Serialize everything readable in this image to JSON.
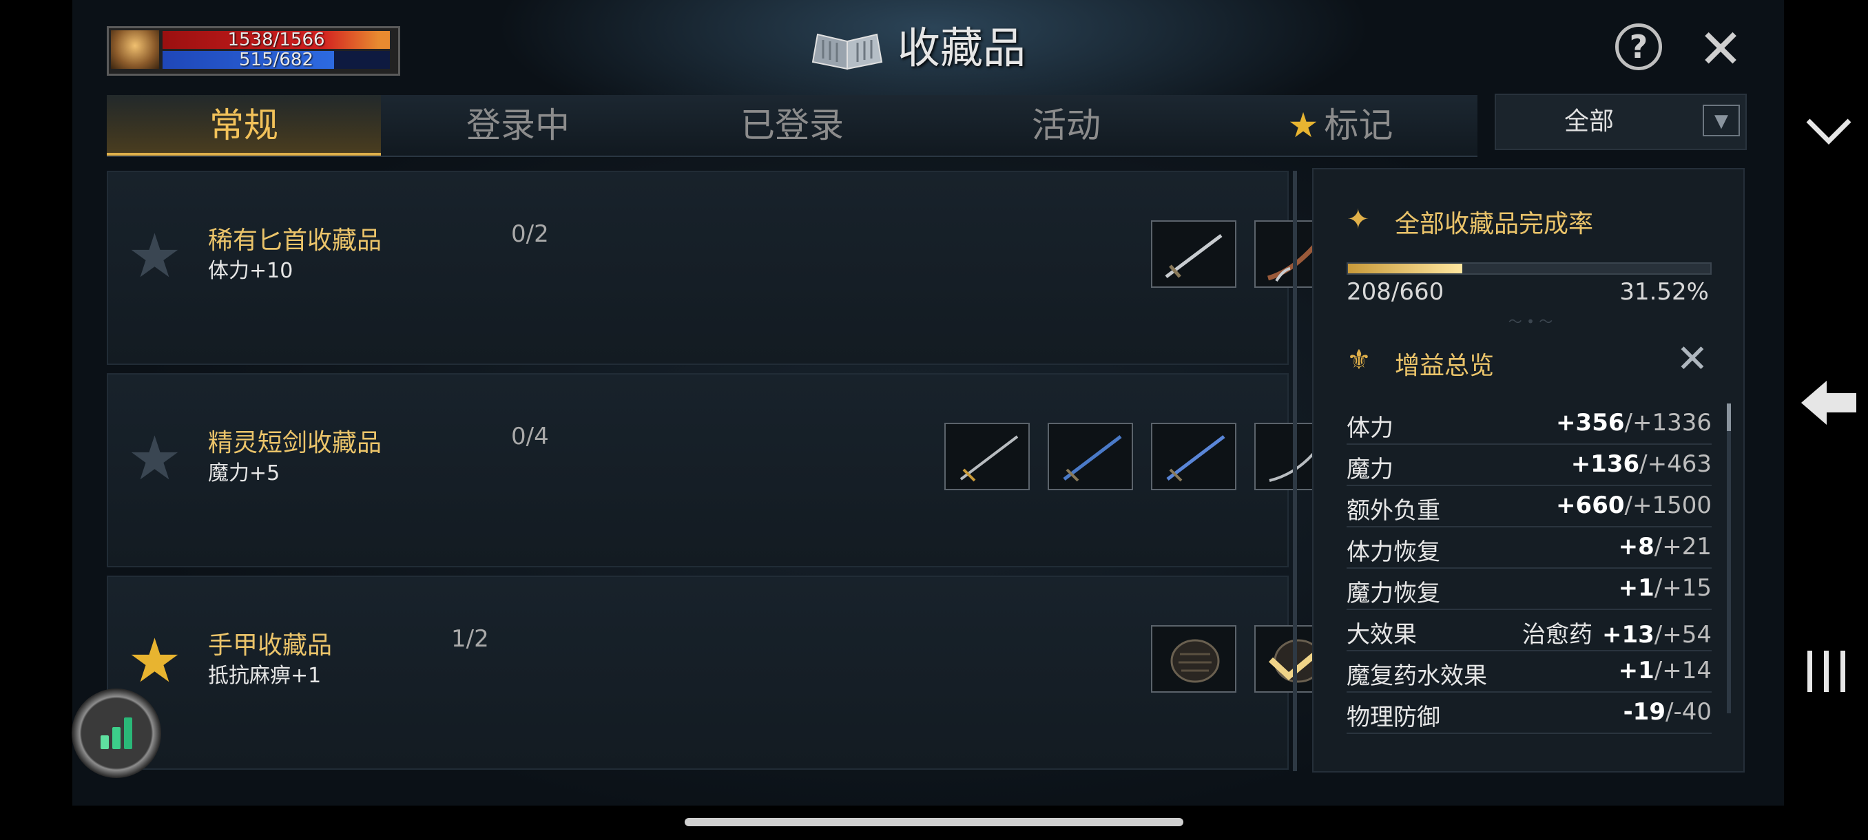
{
  "status": {
    "hp": "1538/1566",
    "mp": "515/682",
    "mp_fraction": 0.755
  },
  "header": {
    "title": "收藏品",
    "title_icon": "open-book-icon",
    "help_icon": "question-circle-icon",
    "close_icon": "close-x-icon"
  },
  "tabs": [
    {
      "label": "常规",
      "active": true
    },
    {
      "label": "登录中",
      "active": false
    },
    {
      "label": "已登录",
      "active": false
    },
    {
      "label": "活动",
      "active": false
    },
    {
      "label": "标记",
      "active": false,
      "icon": "star-icon"
    }
  ],
  "filter": {
    "label": "全部",
    "icon": "dropdown-arrow-icon"
  },
  "collections": [
    {
      "name": "稀有匕首收藏品",
      "count": "0/2",
      "bonus": "体力+10",
      "starred": false,
      "slots": 2,
      "items": [
        "dagger",
        "curved-dagger"
      ]
    },
    {
      "name": "精灵短剑收藏品",
      "count": "0/4",
      "bonus": "魔力+5",
      "starred": false,
      "slots": 4,
      "items": [
        "short-sword",
        "blue-short-sword",
        "blue-short-sword",
        "curved-sword"
      ]
    },
    {
      "name": "手甲收藏品",
      "count": "1/2",
      "bonus": "抵抗麻痹+1",
      "starred": true,
      "slots": 2,
      "items": [
        "gauntlet",
        "gauntlet-checked"
      ]
    }
  ],
  "side": {
    "completion_title": "全部收藏品完成率",
    "completion_count": "208/660",
    "completion_percent": "31.52%",
    "completion_fraction": 0.3152,
    "buff_title": "增益总览",
    "buffs": [
      {
        "name": "体力",
        "cur": "+356",
        "tot": "/+1336"
      },
      {
        "name": "魔力",
        "cur": "+136",
        "tot": "/+463"
      },
      {
        "name": "额外负重",
        "cur": "+660",
        "tot": "/+1500"
      },
      {
        "name": "体力恢复",
        "cur": "+8",
        "tot": "/+21"
      },
      {
        "name": "魔力恢复",
        "cur": "+1",
        "tot": "/+15"
      },
      {
        "name": "大效果",
        "extra": "治愈药",
        "cur": "+13",
        "tot": "/+54"
      },
      {
        "name": "魔复药水效果",
        "cur": "+1",
        "tot": "/+14"
      },
      {
        "name": "物理防御",
        "cur": "-19",
        "tot": "/-40"
      }
    ]
  },
  "colors": {
    "gold": "#ebc46a",
    "tab_active": "#f2c25a",
    "star_on": "#e8b430"
  }
}
